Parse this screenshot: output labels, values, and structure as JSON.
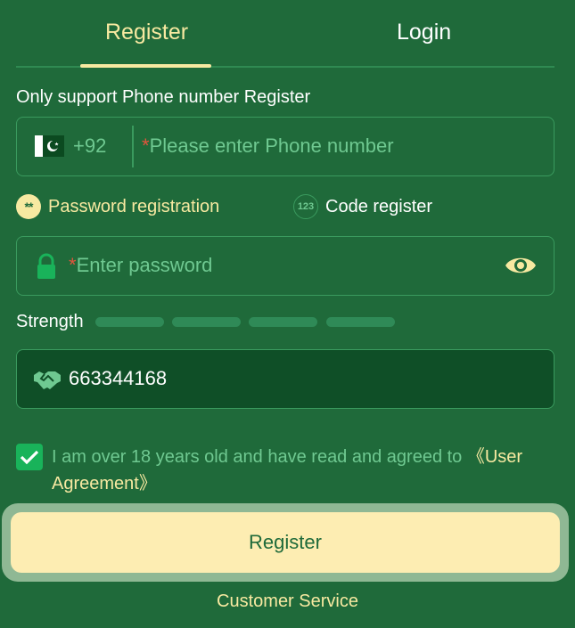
{
  "tabs": {
    "register": "Register",
    "login": "Login"
  },
  "support_label": "Only support Phone number Register",
  "phone": {
    "country_code": "+92",
    "required_mark": "*",
    "placeholder": "Please enter Phone number"
  },
  "modes": {
    "password_label": "Password registration",
    "code_label": "Code register",
    "password_icon_text": "**",
    "code_icon_text": "123"
  },
  "password": {
    "required_mark": "*",
    "placeholder": "Enter password"
  },
  "strength": {
    "label": "Strength",
    "level": 0,
    "segments": 4
  },
  "invite": {
    "value": "663344168"
  },
  "agreement": {
    "checked": true,
    "text": "I am over 18 years old and have read and agreed to ",
    "link": "《User Agreement》"
  },
  "register_button": "Register",
  "customer_service": "Customer Service",
  "colors": {
    "background": "#1f6a3a",
    "accent": "#f7e9a1",
    "muted_text": "#6fc991",
    "required": "#e2553d",
    "checkbox": "#19b35a"
  }
}
